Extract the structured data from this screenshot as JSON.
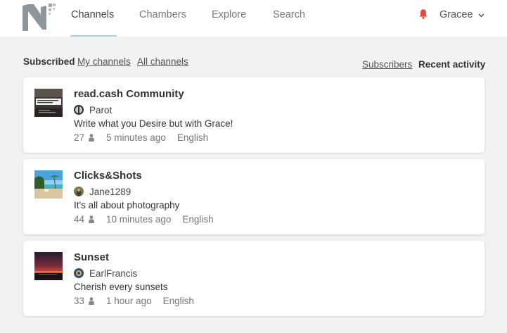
{
  "header": {
    "tabs": [
      {
        "label": "Channels",
        "active": true
      },
      {
        "label": "Chambers",
        "active": false
      },
      {
        "label": "Explore",
        "active": false
      },
      {
        "label": "Search",
        "active": false
      }
    ],
    "notification_icon": "bell-icon",
    "user": {
      "name": "Gracee",
      "menu_icon": "chevron-down-icon"
    }
  },
  "filters": {
    "scope": [
      {
        "label": "Subscribed",
        "current": true
      },
      {
        "label": "My channels",
        "current": false
      },
      {
        "label": "All channels",
        "current": false
      }
    ],
    "sort": [
      {
        "label": "Subscribers",
        "current": false
      },
      {
        "label": "Recent activity",
        "current": true
      }
    ]
  },
  "channels": [
    {
      "title": "read.cash Community",
      "thumbnail": "read-cash-logo",
      "owner": "Parot",
      "description": "Write what you Desire but with Grace!",
      "subscribers": "27",
      "last_activity": "5 minutes ago",
      "language": "English"
    },
    {
      "title": "Clicks&Shots",
      "thumbnail": "beach-photo",
      "owner": "Jane1289",
      "description": "It's all about photography",
      "subscribers": "44",
      "last_activity": "10 minutes ago",
      "language": "English"
    },
    {
      "title": "Sunset",
      "thumbnail": "sunset-photo",
      "owner": "EarlFrancis",
      "description": "Cherish every sunsets",
      "subscribers": "33",
      "last_activity": "1 hour ago",
      "language": "English"
    }
  ],
  "colors": {
    "accent_underline": "#a8cfe0",
    "bell": "#e84545",
    "page_bg": "#f2f2f3"
  }
}
